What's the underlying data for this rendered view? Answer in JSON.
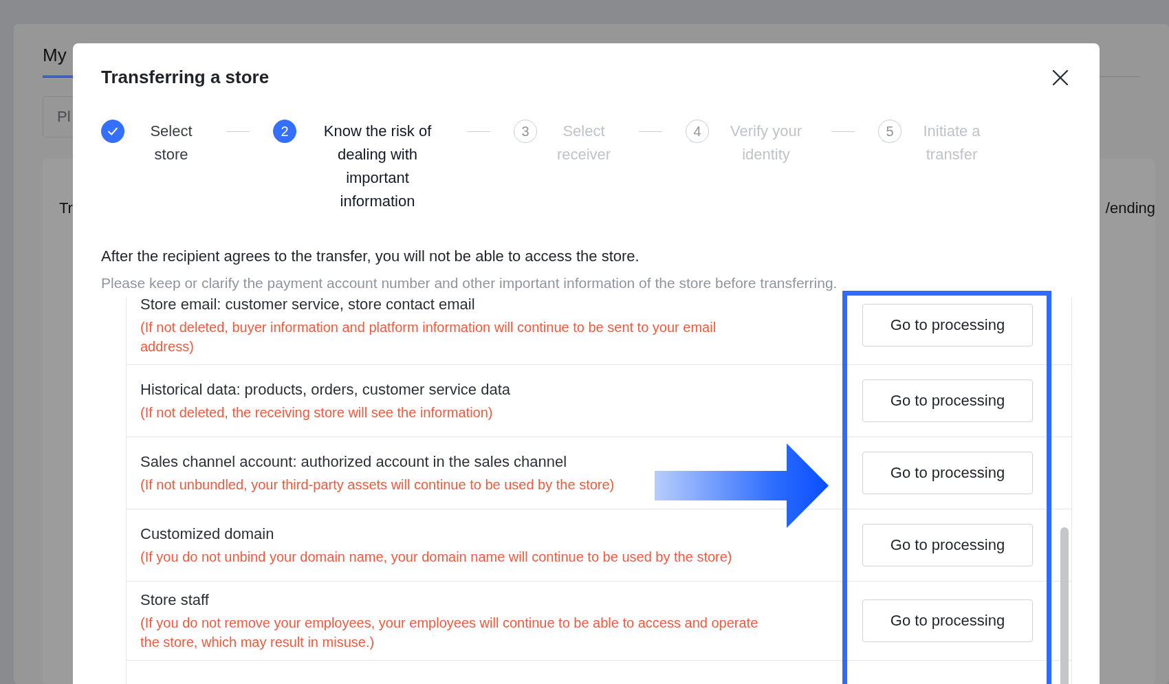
{
  "background_page": {
    "tab": "My",
    "search": {
      "placeholder": "Pl"
    },
    "table_text_left": "Tr",
    "table_text_right": "/ending"
  },
  "dialog": {
    "title": "Transferring a store",
    "steps": [
      {
        "label": "Select store",
        "completed": true,
        "selected": false
      },
      {
        "number": "2",
        "label": "Know the risk of dealing with important information",
        "completed": false,
        "selected": true
      },
      {
        "number": "3",
        "label": "Select receiver",
        "completed": false,
        "selected": false
      },
      {
        "number": "4",
        "label": "Verify your identity",
        "completed": false,
        "selected": false
      },
      {
        "number": "5",
        "label": "Initiate a transfer",
        "completed": false,
        "selected": false
      }
    ],
    "notice": "After the recipient agrees to the transfer, you will not be able to access the store.",
    "hint": "Please keep or clarify the payment account number and other important information of the store before transferring.",
    "items": [
      {
        "title": "Store email: customer service, store contact email",
        "warning": "(If not deleted, buyer information and platform information will continue to be sent to your email address)",
        "button": "Go to processing"
      },
      {
        "title": "Historical data: products, orders, customer service data",
        "warning": "(If not deleted, the receiving store will see the information)",
        "button": "Go to processing"
      },
      {
        "title": "Sales channel account: authorized account in the sales channel",
        "warning": "(If not unbundled, your third-party assets will continue to be used by the store)",
        "button": "Go to processing"
      },
      {
        "title": "Customized domain",
        "warning": "(If you do not unbind your domain name, your domain name will continue to be used by the store)",
        "button": "Go to processing"
      },
      {
        "title": "Store staff",
        "warning": "(If you do not remove your employees, your employees will continue to be able to access and operate the store, which may result in misuse.)",
        "button": "Go to processing"
      }
    ]
  }
}
